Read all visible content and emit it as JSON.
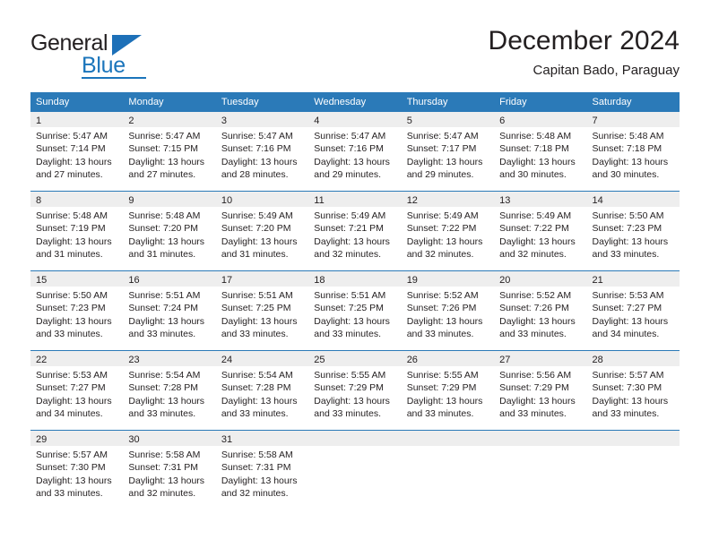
{
  "brand": {
    "name_part1": "General",
    "name_part2": "Blue",
    "triangle_color": "#1d70b8",
    "blue_color": "#1b75bb"
  },
  "header": {
    "title": "December 2024",
    "subtitle": "Capitan Bado, Paraguay"
  },
  "theme": {
    "header_row_bg": "#2b7ab8",
    "daynum_band_bg": "#eeeeee",
    "text_color": "#231f20",
    "cell_bg": "#ffffff"
  },
  "weekdays": [
    {
      "label": "Sunday"
    },
    {
      "label": "Monday"
    },
    {
      "label": "Tuesday"
    },
    {
      "label": "Wednesday"
    },
    {
      "label": "Thursday"
    },
    {
      "label": "Friday"
    },
    {
      "label": "Saturday"
    }
  ],
  "weeks": [
    {
      "days": [
        {
          "num": "1",
          "sunrise": "Sunrise: 5:47 AM",
          "sunset": "Sunset: 7:14 PM",
          "daylight1": "Daylight: 13 hours",
          "daylight2": "and 27 minutes."
        },
        {
          "num": "2",
          "sunrise": "Sunrise: 5:47 AM",
          "sunset": "Sunset: 7:15 PM",
          "daylight1": "Daylight: 13 hours",
          "daylight2": "and 27 minutes."
        },
        {
          "num": "3",
          "sunrise": "Sunrise: 5:47 AM",
          "sunset": "Sunset: 7:16 PM",
          "daylight1": "Daylight: 13 hours",
          "daylight2": "and 28 minutes."
        },
        {
          "num": "4",
          "sunrise": "Sunrise: 5:47 AM",
          "sunset": "Sunset: 7:16 PM",
          "daylight1": "Daylight: 13 hours",
          "daylight2": "and 29 minutes."
        },
        {
          "num": "5",
          "sunrise": "Sunrise: 5:47 AM",
          "sunset": "Sunset: 7:17 PM",
          "daylight1": "Daylight: 13 hours",
          "daylight2": "and 29 minutes."
        },
        {
          "num": "6",
          "sunrise": "Sunrise: 5:48 AM",
          "sunset": "Sunset: 7:18 PM",
          "daylight1": "Daylight: 13 hours",
          "daylight2": "and 30 minutes."
        },
        {
          "num": "7",
          "sunrise": "Sunrise: 5:48 AM",
          "sunset": "Sunset: 7:18 PM",
          "daylight1": "Daylight: 13 hours",
          "daylight2": "and 30 minutes."
        }
      ]
    },
    {
      "days": [
        {
          "num": "8",
          "sunrise": "Sunrise: 5:48 AM",
          "sunset": "Sunset: 7:19 PM",
          "daylight1": "Daylight: 13 hours",
          "daylight2": "and 31 minutes."
        },
        {
          "num": "9",
          "sunrise": "Sunrise: 5:48 AM",
          "sunset": "Sunset: 7:20 PM",
          "daylight1": "Daylight: 13 hours",
          "daylight2": "and 31 minutes."
        },
        {
          "num": "10",
          "sunrise": "Sunrise: 5:49 AM",
          "sunset": "Sunset: 7:20 PM",
          "daylight1": "Daylight: 13 hours",
          "daylight2": "and 31 minutes."
        },
        {
          "num": "11",
          "sunrise": "Sunrise: 5:49 AM",
          "sunset": "Sunset: 7:21 PM",
          "daylight1": "Daylight: 13 hours",
          "daylight2": "and 32 minutes."
        },
        {
          "num": "12",
          "sunrise": "Sunrise: 5:49 AM",
          "sunset": "Sunset: 7:22 PM",
          "daylight1": "Daylight: 13 hours",
          "daylight2": "and 32 minutes."
        },
        {
          "num": "13",
          "sunrise": "Sunrise: 5:49 AM",
          "sunset": "Sunset: 7:22 PM",
          "daylight1": "Daylight: 13 hours",
          "daylight2": "and 32 minutes."
        },
        {
          "num": "14",
          "sunrise": "Sunrise: 5:50 AM",
          "sunset": "Sunset: 7:23 PM",
          "daylight1": "Daylight: 13 hours",
          "daylight2": "and 33 minutes."
        }
      ]
    },
    {
      "days": [
        {
          "num": "15",
          "sunrise": "Sunrise: 5:50 AM",
          "sunset": "Sunset: 7:23 PM",
          "daylight1": "Daylight: 13 hours",
          "daylight2": "and 33 minutes."
        },
        {
          "num": "16",
          "sunrise": "Sunrise: 5:51 AM",
          "sunset": "Sunset: 7:24 PM",
          "daylight1": "Daylight: 13 hours",
          "daylight2": "and 33 minutes."
        },
        {
          "num": "17",
          "sunrise": "Sunrise: 5:51 AM",
          "sunset": "Sunset: 7:25 PM",
          "daylight1": "Daylight: 13 hours",
          "daylight2": "and 33 minutes."
        },
        {
          "num": "18",
          "sunrise": "Sunrise: 5:51 AM",
          "sunset": "Sunset: 7:25 PM",
          "daylight1": "Daylight: 13 hours",
          "daylight2": "and 33 minutes."
        },
        {
          "num": "19",
          "sunrise": "Sunrise: 5:52 AM",
          "sunset": "Sunset: 7:26 PM",
          "daylight1": "Daylight: 13 hours",
          "daylight2": "and 33 minutes."
        },
        {
          "num": "20",
          "sunrise": "Sunrise: 5:52 AM",
          "sunset": "Sunset: 7:26 PM",
          "daylight1": "Daylight: 13 hours",
          "daylight2": "and 33 minutes."
        },
        {
          "num": "21",
          "sunrise": "Sunrise: 5:53 AM",
          "sunset": "Sunset: 7:27 PM",
          "daylight1": "Daylight: 13 hours",
          "daylight2": "and 34 minutes."
        }
      ]
    },
    {
      "days": [
        {
          "num": "22",
          "sunrise": "Sunrise: 5:53 AM",
          "sunset": "Sunset: 7:27 PM",
          "daylight1": "Daylight: 13 hours",
          "daylight2": "and 34 minutes."
        },
        {
          "num": "23",
          "sunrise": "Sunrise: 5:54 AM",
          "sunset": "Sunset: 7:28 PM",
          "daylight1": "Daylight: 13 hours",
          "daylight2": "and 33 minutes."
        },
        {
          "num": "24",
          "sunrise": "Sunrise: 5:54 AM",
          "sunset": "Sunset: 7:28 PM",
          "daylight1": "Daylight: 13 hours",
          "daylight2": "and 33 minutes."
        },
        {
          "num": "25",
          "sunrise": "Sunrise: 5:55 AM",
          "sunset": "Sunset: 7:29 PM",
          "daylight1": "Daylight: 13 hours",
          "daylight2": "and 33 minutes."
        },
        {
          "num": "26",
          "sunrise": "Sunrise: 5:55 AM",
          "sunset": "Sunset: 7:29 PM",
          "daylight1": "Daylight: 13 hours",
          "daylight2": "and 33 minutes."
        },
        {
          "num": "27",
          "sunrise": "Sunrise: 5:56 AM",
          "sunset": "Sunset: 7:29 PM",
          "daylight1": "Daylight: 13 hours",
          "daylight2": "and 33 minutes."
        },
        {
          "num": "28",
          "sunrise": "Sunrise: 5:57 AM",
          "sunset": "Sunset: 7:30 PM",
          "daylight1": "Daylight: 13 hours",
          "daylight2": "and 33 minutes."
        }
      ]
    },
    {
      "days": [
        {
          "num": "29",
          "sunrise": "Sunrise: 5:57 AM",
          "sunset": "Sunset: 7:30 PM",
          "daylight1": "Daylight: 13 hours",
          "daylight2": "and 33 minutes."
        },
        {
          "num": "30",
          "sunrise": "Sunrise: 5:58 AM",
          "sunset": "Sunset: 7:31 PM",
          "daylight1": "Daylight: 13 hours",
          "daylight2": "and 32 minutes."
        },
        {
          "num": "31",
          "sunrise": "Sunrise: 5:58 AM",
          "sunset": "Sunset: 7:31 PM",
          "daylight1": "Daylight: 13 hours",
          "daylight2": "and 32 minutes."
        },
        {
          "num": "",
          "sunrise": "",
          "sunset": "",
          "daylight1": "",
          "daylight2": ""
        },
        {
          "num": "",
          "sunrise": "",
          "sunset": "",
          "daylight1": "",
          "daylight2": ""
        },
        {
          "num": "",
          "sunrise": "",
          "sunset": "",
          "daylight1": "",
          "daylight2": ""
        },
        {
          "num": "",
          "sunrise": "",
          "sunset": "",
          "daylight1": "",
          "daylight2": ""
        }
      ]
    }
  ]
}
